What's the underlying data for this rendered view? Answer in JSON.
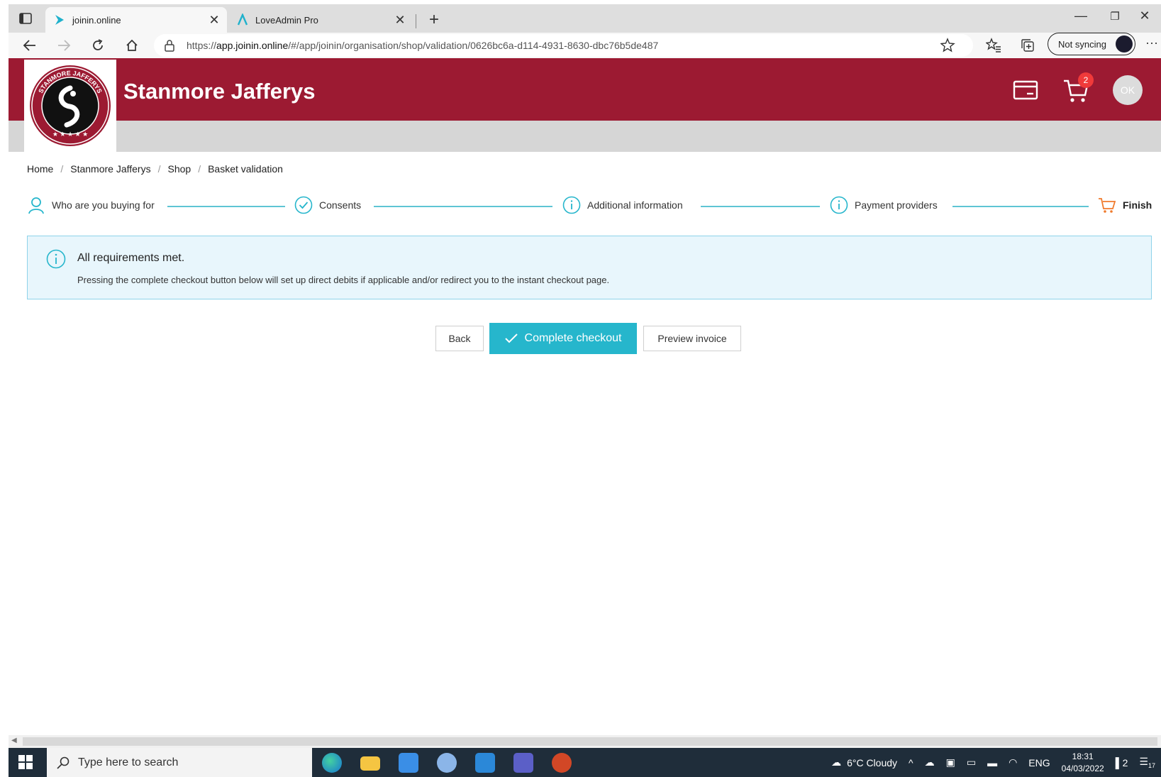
{
  "browser": {
    "tabs": [
      {
        "title": "joinin.online",
        "active": true
      },
      {
        "title": "LoveAdmin Pro",
        "active": false
      }
    ],
    "url_prefix": "https://",
    "url_host": "app.joinin.online",
    "url_path": "/#/app/joinin/organisation/shop/validation/0626bc6a-d114-4931-8630-dbc76b5de487",
    "sync_label": "Not syncing",
    "accent": "#26b6cc"
  },
  "header": {
    "org_name": "Stanmore Jafferys",
    "brand_color": "#9c1a32",
    "logo_text": "STANMORE JAFFERYS",
    "cart_count": "2",
    "user_initials": "OK"
  },
  "breadcrumb": [
    "Home",
    "Stanmore Jafferys",
    "Shop",
    "Basket validation"
  ],
  "stepper": {
    "steps": [
      {
        "label": "Who are you buying for",
        "icon": "user-icon"
      },
      {
        "label": "Consents",
        "icon": "check-circle-icon"
      },
      {
        "label": "Additional information",
        "icon": "info-circle-icon"
      },
      {
        "label": "Payment providers",
        "icon": "info-circle-icon"
      },
      {
        "label": "Finish",
        "icon": "cart-icon"
      }
    ]
  },
  "info": {
    "heading": "All requirements met.",
    "body": "Pressing the complete checkout button below will set up direct debits if applicable and/or redirect you to the instant checkout page."
  },
  "actions": {
    "back": "Back",
    "complete": "Complete checkout",
    "preview": "Preview invoice"
  },
  "taskbar": {
    "search_placeholder": "Type here to search",
    "weather": "6°C  Cloudy",
    "lang": "ENG",
    "time": "18:31",
    "date": "04/03/2022",
    "notif_count": "2",
    "notif_center_count": "17"
  }
}
